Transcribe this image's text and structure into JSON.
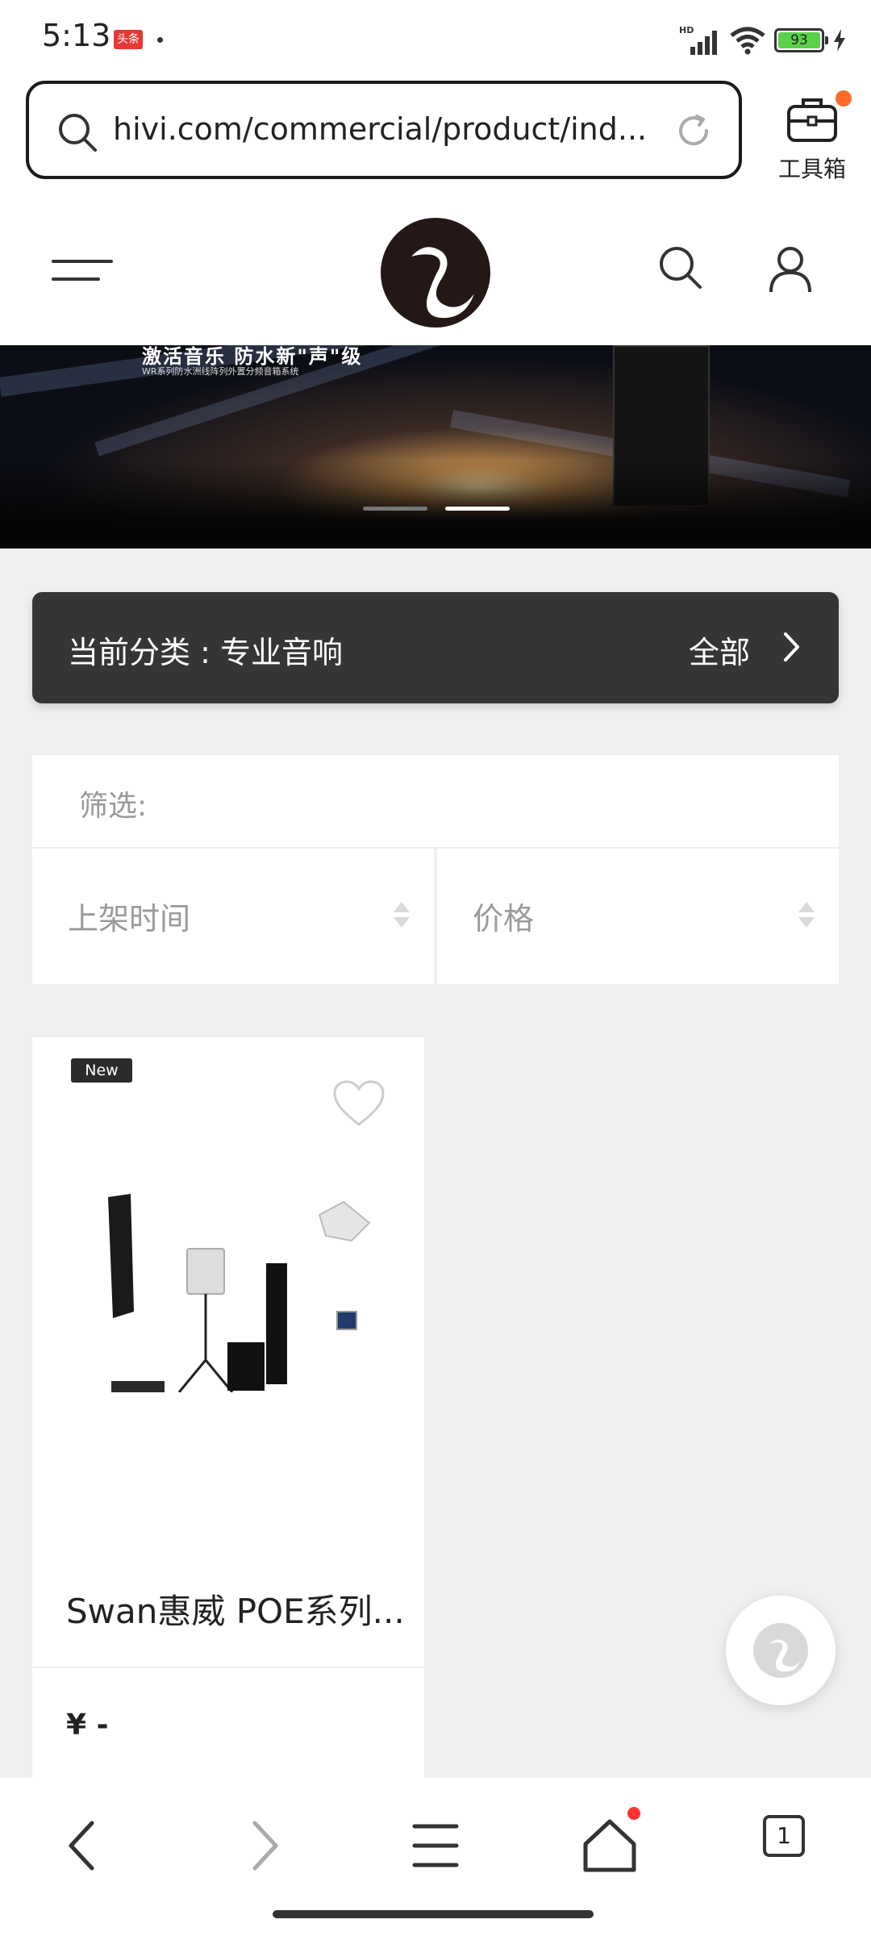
{
  "status_bar": {
    "time": "5:13",
    "badge": "头条",
    "battery": "93",
    "signal": "HD"
  },
  "browser": {
    "url": "hivi.com/commercial/product/ind...",
    "toolbox_label": "工具箱"
  },
  "banner": {
    "title": "激活音乐 防水新\"声\"级",
    "subtitle": "WR系列防水洲线阵列外置分频音箱系统"
  },
  "category": {
    "label": "当前分类 : 专业音响",
    "all": "全部"
  },
  "filter": {
    "label": "筛选:",
    "sort_time": "上架时间",
    "sort_price": "价格"
  },
  "product": {
    "badge": "New",
    "name": "Swan惠威 POE系列...",
    "price": "¥ -"
  },
  "bottom_nav": {
    "tab_count": "1"
  },
  "colors": {
    "accent": "#ff6a2b",
    "dark_bar": "#353535",
    "notify": "#f33333"
  }
}
